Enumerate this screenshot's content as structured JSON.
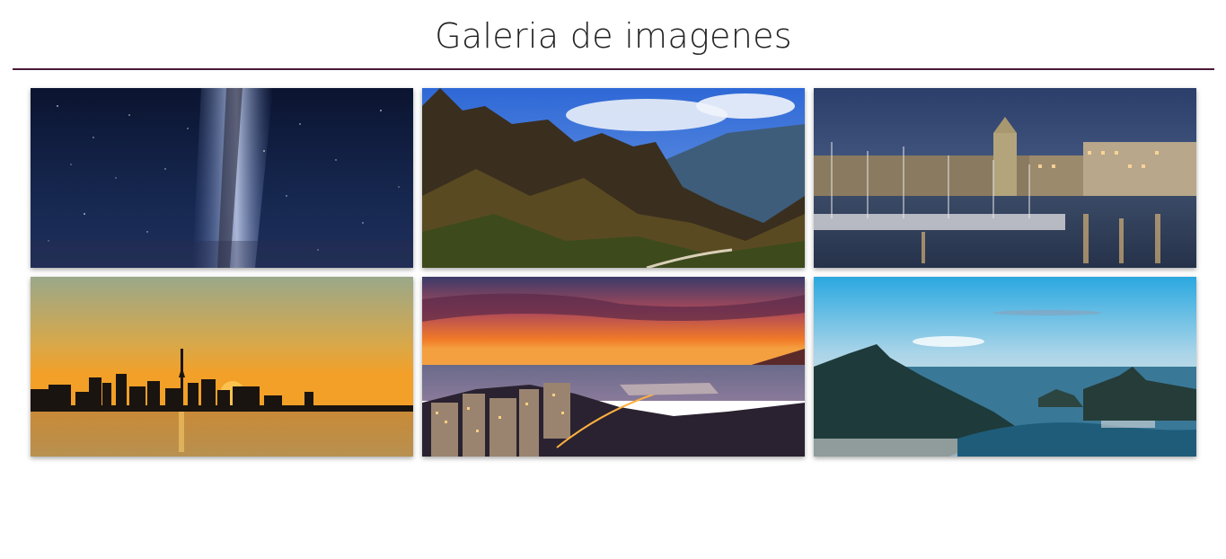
{
  "header": {
    "title": "Galeria de imagenes",
    "rule_color": "#4a1838"
  },
  "gallery": {
    "images": [
      {
        "name": "milky-way-image"
      },
      {
        "name": "mountain-valley-image"
      },
      {
        "name": "harbor-night-image"
      },
      {
        "name": "city-skyline-sunset-image"
      },
      {
        "name": "coastal-city-dusk-image"
      },
      {
        "name": "rio-bay-view-image"
      }
    ]
  }
}
